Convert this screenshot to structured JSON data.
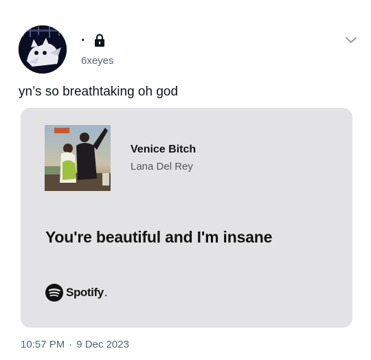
{
  "post": {
    "display_name": "·",
    "lock_icon": "lock-icon",
    "handle": "6xeyes",
    "menu_icon": "chevron-down-icon",
    "text": "yn’s so breathtaking oh god",
    "time": "10:57 PM",
    "separator": "·",
    "date": "9 Dec 2023"
  },
  "card": {
    "song_title": "Venice Bitch",
    "artist": "Lana Del Rey",
    "lyric": "You're beautiful and I'm insane",
    "brand": "Spotify",
    "brand_mark": ".",
    "brand_icon": "spotify-icon",
    "background": "#e3e3e5"
  },
  "colors": {
    "text_primary": "#0f1419",
    "text_secondary": "#536471"
  }
}
